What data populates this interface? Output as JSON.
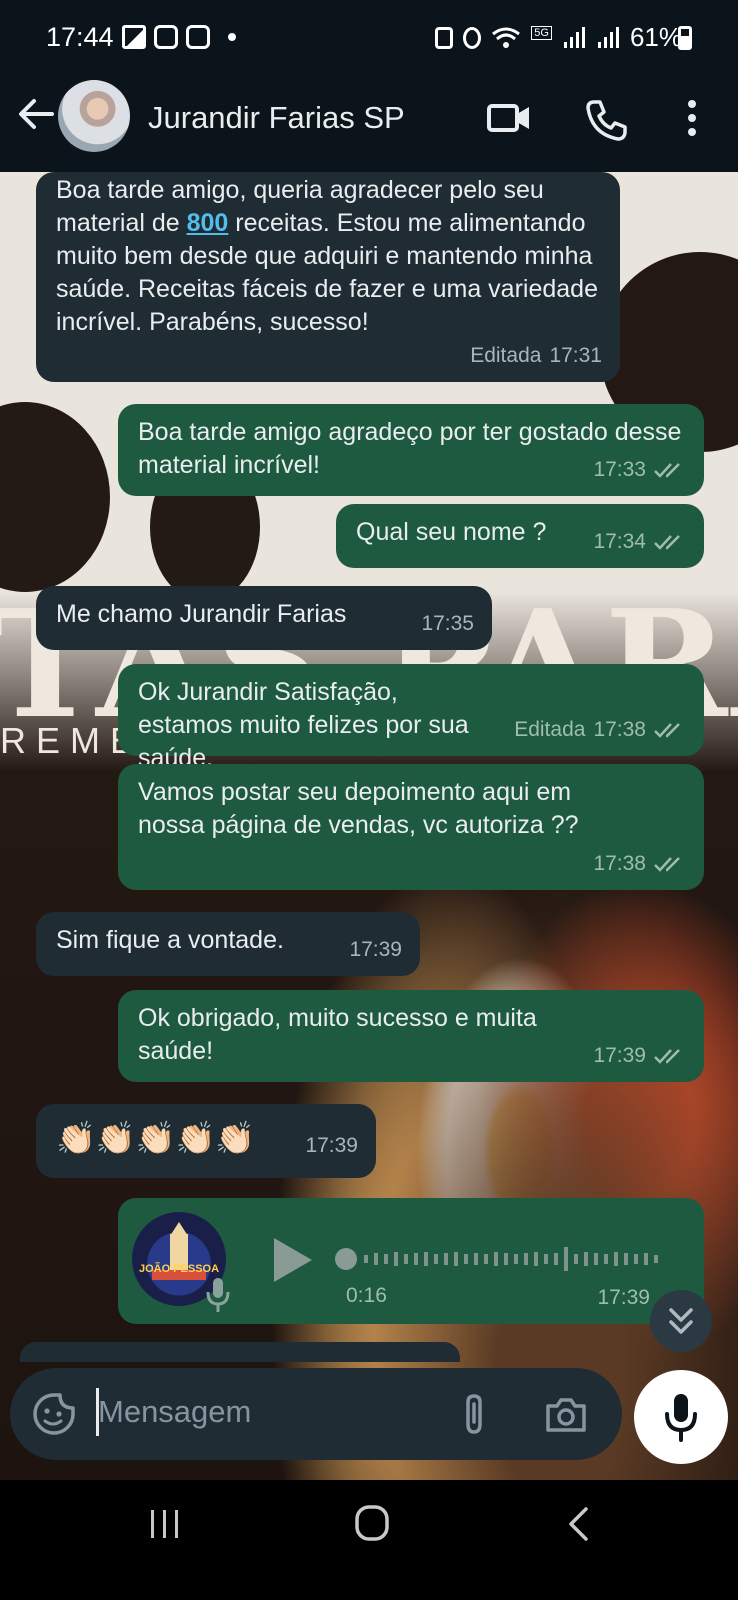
{
  "status_bar": {
    "time": "17:44",
    "network_badge": "5G",
    "battery": "61%"
  },
  "header": {
    "contact_name": "Jurandir Farias SP",
    "icons": [
      "back-arrow-icon",
      "video-call-icon",
      "phone-icon",
      "more-vert-icon"
    ]
  },
  "background": {
    "text": "TAS PARA DIABÉ",
    "subtext": "REME"
  },
  "messages": [
    {
      "direction": "in",
      "text_before_link": "Boa tarde amigo, queria agradecer pelo seu material de ",
      "link": "800",
      "text_after_link": " receitas. Estou me alimentando muito bem desde que adquiri e mantendo minha saúde. Receitas fáceis de fazer e uma variedade incrível. Parabéns, sucesso!",
      "edited": "Editada",
      "time": "17:31"
    },
    {
      "direction": "out",
      "text": "Boa tarde amigo agradeço por ter gostado desse material incrível!",
      "time": "17:33"
    },
    {
      "direction": "out",
      "text": "Qual seu nome ?",
      "time": "17:34"
    },
    {
      "direction": "in",
      "text": "Me chamo Jurandir Farias",
      "time": "17:35"
    },
    {
      "direction": "out",
      "text": "Ok Jurandir Satisfação, estamos muito felizes por sua saúde.",
      "edited": "Editada",
      "time": "17:38"
    },
    {
      "direction": "out",
      "text": "Vamos postar seu depoimento aqui em nossa página de vendas, vc autoriza ??",
      "time": "17:38"
    },
    {
      "direction": "in",
      "text": "Sim fique a vontade.",
      "time": "17:39"
    },
    {
      "direction": "out",
      "text": "Ok obrigado, muito sucesso e muita saúde!",
      "time": "17:39"
    },
    {
      "direction": "in",
      "text": "👏🏻👏🏻👏🏻👏🏻👏🏻",
      "time": "17:39"
    },
    {
      "direction": "out",
      "type": "voice",
      "avatar_text": "JOÃO PESSOA",
      "duration": "0:16",
      "time": "17:39"
    }
  ],
  "input": {
    "placeholder": "Mensagem"
  },
  "colors": {
    "incoming_bubble": "#1f2c34",
    "outgoing_bubble": "#1d5a3f",
    "link": "#53bdeb",
    "read_ticks": "#9fbdad"
  }
}
